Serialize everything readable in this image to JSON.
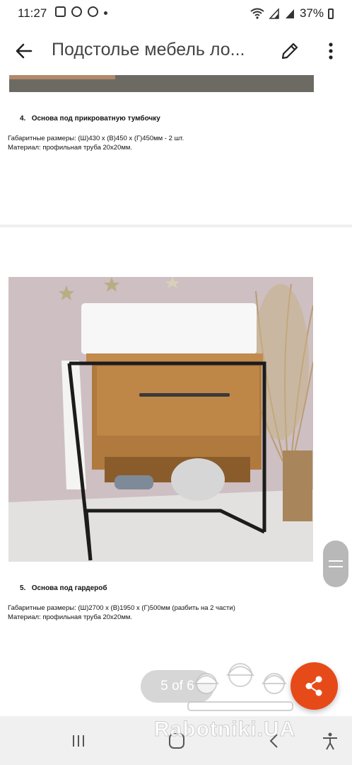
{
  "status_bar": {
    "time": "11:27",
    "battery": "37%"
  },
  "app_bar": {
    "title": "Подстолье мебель ло..."
  },
  "document": {
    "item4": {
      "number": "4.",
      "heading": "Основа под прикроватную тумбочку",
      "dimensions": "Габаритные размеры: (Ш)430 х (В)450 х (Г)450мм - 2 шт.",
      "material": "Материал: профильная труба 20х20мм."
    },
    "item5": {
      "number": "5.",
      "heading": "Основа под гардероб",
      "dimensions": "Габаритные размеры: (Ш)2700 х (В)1950 х (Г)500мм  (разбить на 2 части)",
      "material": "Материал: профильная труба 20х20мм."
    }
  },
  "pager": {
    "label": "5 of 6"
  },
  "watermark": "Rabotniki.UA",
  "colors": {
    "fab": "#e64a19",
    "frame": "#1c1c1c",
    "wood": "#b07a3e"
  }
}
